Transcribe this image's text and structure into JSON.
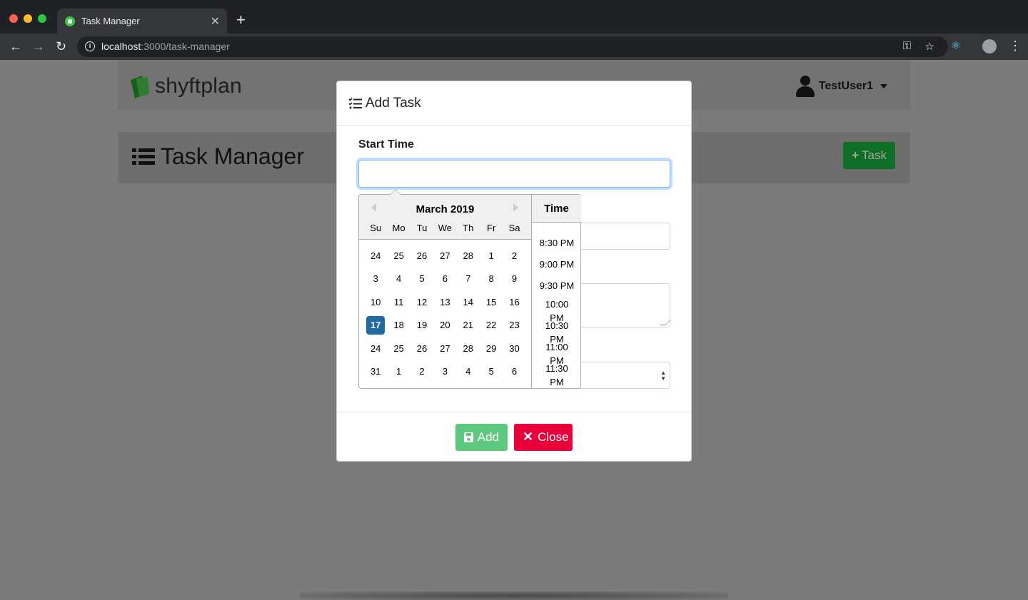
{
  "browser": {
    "tab_title": "Task Manager",
    "url_host": "localhost",
    "url_path": ":3000/task-manager"
  },
  "app": {
    "logo_text": "shyftplan",
    "user_name": "TestUser1",
    "page_title": "Task Manager",
    "add_task_label": "Task"
  },
  "modal": {
    "title": "Add Task",
    "start_time_label": "Start Time",
    "start_time_value": "",
    "add_label": "Add",
    "close_label": "Close"
  },
  "datepicker": {
    "month_title": "March 2019",
    "time_header": "Time",
    "weekdays": [
      "Su",
      "Mo",
      "Tu",
      "We",
      "Th",
      "Fr",
      "Sa"
    ],
    "weeks": [
      [
        "24",
        "25",
        "26",
        "27",
        "28",
        "1",
        "2"
      ],
      [
        "3",
        "4",
        "5",
        "6",
        "7",
        "8",
        "9"
      ],
      [
        "10",
        "11",
        "12",
        "13",
        "14",
        "15",
        "16"
      ],
      [
        "17",
        "18",
        "19",
        "20",
        "21",
        "22",
        "23"
      ],
      [
        "24",
        "25",
        "26",
        "27",
        "28",
        "29",
        "30"
      ],
      [
        "31",
        "1",
        "2",
        "3",
        "4",
        "5",
        "6"
      ]
    ],
    "selected_day": "17",
    "times": [
      "8:30 PM",
      "9:00 PM",
      "9:30 PM",
      "10:00 PM",
      "10:30 PM",
      "11:00 PM",
      "11:30 PM"
    ]
  },
  "colors": {
    "selected_day": "#216ba5",
    "add_button": "#5dc97f",
    "close_button": "#e8003a",
    "task_button": "#0f6e25"
  }
}
